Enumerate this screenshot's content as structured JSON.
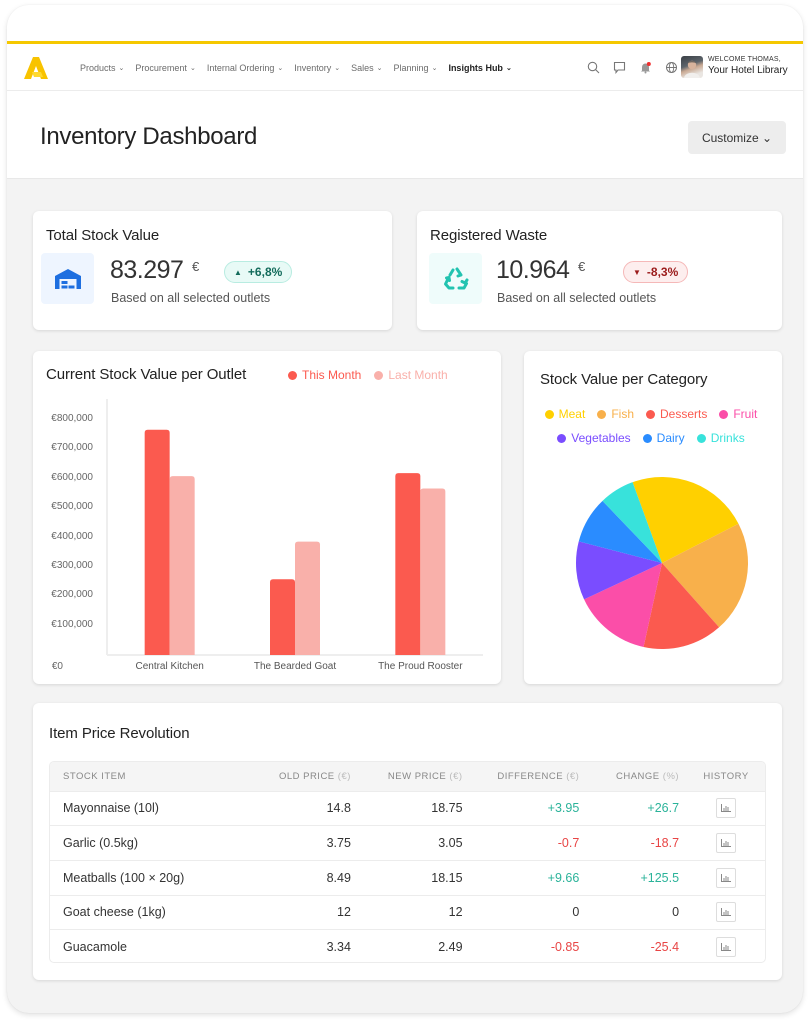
{
  "nav": {
    "items": [
      {
        "label": "Products",
        "active": false
      },
      {
        "label": "Procurement",
        "active": false
      },
      {
        "label": "Internal Ordering",
        "active": false
      },
      {
        "label": "Inventory",
        "active": false
      },
      {
        "label": "Sales",
        "active": false
      },
      {
        "label": "Planning",
        "active": false
      },
      {
        "label": "Insights Hub",
        "active": true
      }
    ],
    "chevron": "⌄",
    "icons": [
      "search-icon",
      "chat-icon",
      "notification-bell-icon",
      "globe-icon"
    ],
    "welcome_small": "WELCOME THOMAS,",
    "welcome_big": "Your Hotel Library"
  },
  "header": {
    "title": "Inventory Dashboard",
    "customize_label": "Customize ⌄"
  },
  "kpis": {
    "stock": {
      "title": "Total Stock Value",
      "value": "83.297",
      "currency": "€",
      "change": "+6,8%",
      "direction": "up",
      "arrow": "▲",
      "subtitle": "Based on all selected outlets",
      "icon": "warehouse-icon"
    },
    "waste": {
      "title": "Registered Waste",
      "value": "10.964",
      "currency": "€",
      "change": "-8,3%",
      "direction": "down",
      "arrow": "▼",
      "subtitle": "Based on all selected outlets",
      "icon": "recycle-icon"
    }
  },
  "colors": {
    "brand_yellow": "#f5c800",
    "this_month": "#fb5a4f",
    "last_month": "#f9b0aa",
    "positive": "#2bb39a",
    "negative": "#e84545",
    "stock_icon": "#1e6fe0",
    "waste_icon": "#22c3b0"
  },
  "chart_data": [
    {
      "type": "bar",
      "title": "Current Stock Value per Outlet",
      "categories": [
        "Central Kitchen",
        "The Bearded Goat",
        "The Proud Rooster"
      ],
      "series": [
        {
          "name": "This Month",
          "color": "#fb5a4f",
          "values": [
            767000,
            258000,
            619000
          ]
        },
        {
          "name": "Last Month",
          "color": "#f9b0aa",
          "values": [
            609000,
            386000,
            567000
          ]
        }
      ],
      "yticks": [
        "€0",
        "€100,000",
        "€200,000",
        "€300,000",
        "€400,000",
        "€500,000",
        "€600,000",
        "€700,000",
        "€800,000"
      ],
      "ylim": [
        0,
        800000
      ],
      "xlabel": "",
      "ylabel": "",
      "legend": "top-right",
      "grid": false
    },
    {
      "type": "pie",
      "title": "Stock Value per Category",
      "categories": [
        "Meat",
        "Fish",
        "Desserts",
        "Fruit",
        "Vegetables",
        "Dairy",
        "Drinks"
      ],
      "values": [
        23,
        21,
        15,
        14.6,
        11,
        8.8,
        6.6
      ],
      "colors": [
        "#ffd000",
        "#f8b04b",
        "#fb5a4f",
        "#fb4ea8",
        "#7a4dff",
        "#2a8cff",
        "#38e2db"
      ],
      "start_angle_deg": -20,
      "legend": "top"
    }
  ],
  "table": {
    "title": "Item Price Revolution",
    "columns": [
      {
        "label": "STOCK ITEM",
        "unit": ""
      },
      {
        "label": "OLD PRICE",
        "unit": "(€)"
      },
      {
        "label": "NEW PRICE",
        "unit": "(€)"
      },
      {
        "label": "DIFFERENCE",
        "unit": "(€)"
      },
      {
        "label": "CHANGE",
        "unit": "(%)"
      },
      {
        "label": "HISTORY",
        "unit": ""
      }
    ],
    "rows": [
      {
        "item": "Mayonnaise (10l)",
        "old": "14.8",
        "new": "18.75",
        "diff": "+3.95",
        "change": "+26.7",
        "trend": "pos"
      },
      {
        "item": "Garlic (0.5kg)",
        "old": "3.75",
        "new": "3.05",
        "diff": "-0.7",
        "change": "-18.7",
        "trend": "neg"
      },
      {
        "item": "Meatballs (100 × 20g)",
        "old": "8.49",
        "new": "18.15",
        "diff": "+9.66",
        "change": "+125.5",
        "trend": "pos"
      },
      {
        "item": "Goat cheese (1kg)",
        "old": "12",
        "new": "12",
        "diff": "0",
        "change": "0",
        "trend": "neutral"
      },
      {
        "item": "Guacamole",
        "old": "3.34",
        "new": "2.49",
        "diff": "-0.85",
        "change": "-25.4",
        "trend": "neg"
      }
    ]
  }
}
